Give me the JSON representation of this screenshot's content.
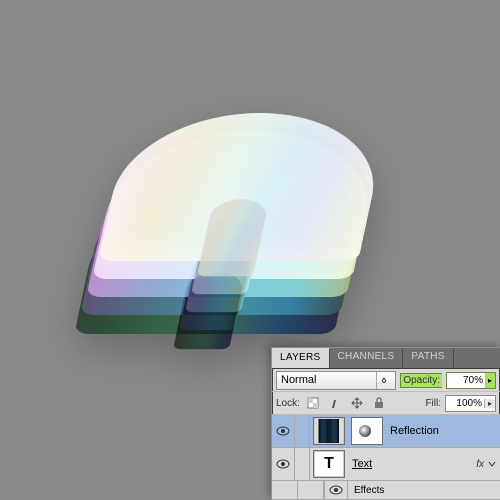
{
  "panel": {
    "tabs": [
      "LAYERS",
      "CHANNELS",
      "PATHS"
    ],
    "active_tab": 0,
    "blend_mode": "Normal",
    "opacity_label": "Opacity:",
    "opacity_value": "70%",
    "lock_label": "Lock:",
    "fill_label": "Fill:",
    "fill_value": "100%",
    "layers": [
      {
        "name": "Reflection",
        "visible": true,
        "selected": true,
        "has_mask": true,
        "thumb": "reflection",
        "fx": false
      },
      {
        "name": "Text",
        "visible": true,
        "selected": false,
        "has_mask": false,
        "thumb": "T",
        "fx": true,
        "underline": true
      }
    ],
    "sublayer": {
      "label": "Effects"
    }
  }
}
